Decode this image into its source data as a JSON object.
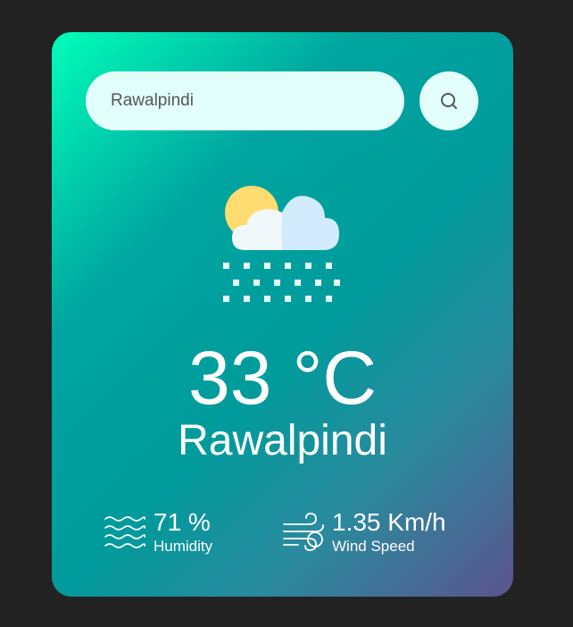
{
  "search": {
    "value": "Rawalpindi",
    "icon": "search-icon"
  },
  "weather": {
    "icon": "cloud-sun-snow-icon",
    "temperature": "33 °C",
    "city": "Rawalpindi"
  },
  "humidity": {
    "value": "71 %",
    "label": "Humidity",
    "icon": "humidity-waves-icon"
  },
  "wind": {
    "value": "1.35 Km/h",
    "label": "Wind Speed",
    "icon": "wind-icon"
  },
  "colors": {
    "page_background": "#222222",
    "card_gradient_start": "#00feba",
    "card_gradient_end": "#5b548e",
    "input_background": "#e2fffc",
    "text": "#ffffff"
  }
}
